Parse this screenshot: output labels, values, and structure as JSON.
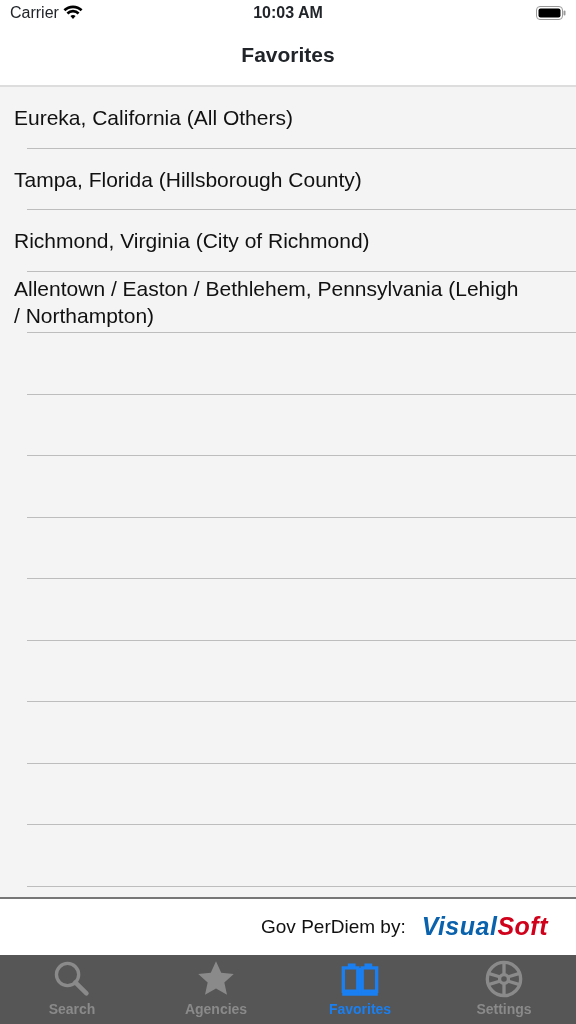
{
  "status_bar": {
    "carrier": "Carrier",
    "time": "10:03 AM"
  },
  "nav": {
    "title": "Favorites"
  },
  "favorites": [
    {
      "label": "Eureka, California (All Others)"
    },
    {
      "label": "Tampa, Florida (Hillsborough County)"
    },
    {
      "label": "Richmond, Virginia (City of Richmond)"
    },
    {
      "label": "Allentown / Easton / Bethlehem, Pennsylvania (Lehigh / Northampton)"
    }
  ],
  "footer": {
    "credit": "Gov PerDiem by:",
    "logo": [
      {
        "text": "Visual",
        "color": "#0a62ad"
      },
      {
        "text": "Soft",
        "color": "#d0021b"
      }
    ]
  },
  "tabs": [
    {
      "label": "Search",
      "kind": "search",
      "selected": false
    },
    {
      "label": "Agencies",
      "kind": "star",
      "selected": false
    },
    {
      "label": "Favorites",
      "kind": "book",
      "selected": true
    },
    {
      "label": "Settings",
      "kind": "wheel",
      "selected": false
    }
  ]
}
